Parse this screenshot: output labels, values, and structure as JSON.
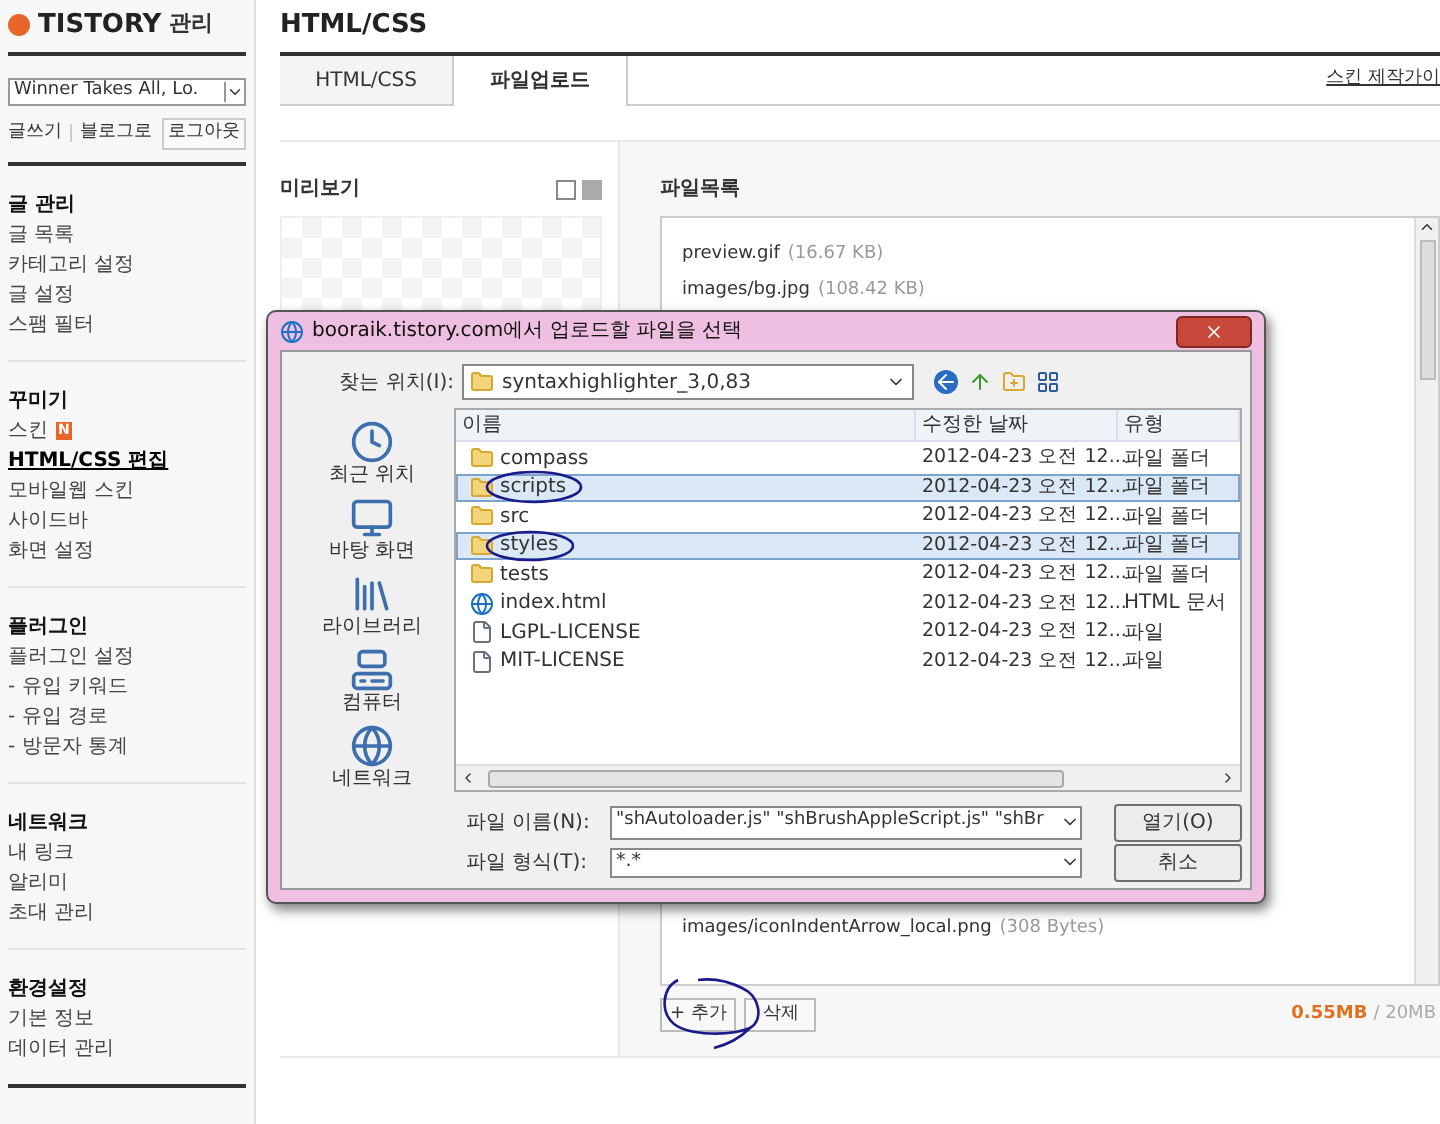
{
  "sidebar": {
    "logo": "TISTORY",
    "logo_suffix": "관리",
    "blog_select": "Winner Takes All, Lo.",
    "links": [
      "글쓰기",
      "블로그로"
    ],
    "logout": "로그아웃",
    "sections": [
      {
        "title": "글 관리",
        "items": [
          {
            "label": "글 목록",
            "selected": false
          },
          {
            "label": "카테고리 설정",
            "selected": false
          },
          {
            "label": "글 설정",
            "selected": false
          },
          {
            "label": "스팸 필터",
            "selected": false
          }
        ]
      },
      {
        "title": "꾸미기",
        "items": [
          {
            "label": "스킨",
            "selected": false,
            "badge": "N"
          },
          {
            "label": "HTML/CSS 편집",
            "selected": true
          },
          {
            "label": "모바일웹 스킨",
            "selected": false
          },
          {
            "label": "사이드바",
            "selected": false
          },
          {
            "label": "화면 설정",
            "selected": false
          }
        ]
      },
      {
        "title": "플러그인",
        "items": [
          {
            "label": "플러그인 설정",
            "selected": false
          },
          {
            "label": "- 유입 키워드",
            "selected": false
          },
          {
            "label": "- 유입 경로",
            "selected": false
          },
          {
            "label": "- 방문자 통계",
            "selected": false
          }
        ]
      },
      {
        "title": "네트워크",
        "items": [
          {
            "label": "내 링크",
            "selected": false
          },
          {
            "label": "알리미",
            "selected": false
          },
          {
            "label": "초대 관리",
            "selected": false
          }
        ]
      },
      {
        "title": "환경설정",
        "items": [
          {
            "label": "기본 정보",
            "selected": false
          },
          {
            "label": "데이터 관리",
            "selected": false
          }
        ]
      }
    ]
  },
  "page": {
    "title": "HTML/CSS",
    "tabs": [
      {
        "label": "HTML/CSS",
        "selected": false
      },
      {
        "label": "파일업로드",
        "selected": true
      }
    ],
    "guide_link": "스킨 제작가이",
    "preview": {
      "title": "미리보기"
    },
    "file_list": {
      "title": "파일목록",
      "rows": [
        {
          "name": "preview.gif",
          "size": "(16.67 KB)"
        },
        {
          "name": "images/bg.jpg",
          "size": "(108.42 KB)"
        }
      ],
      "bottom_rows": [
        {
          "name": "images/iconIndentArrow_local.png",
          "size": "(308 Bytes)"
        }
      ]
    },
    "add_button": "+ 추가",
    "delete_button": "삭제",
    "usage": "0.55MB",
    "quota": "/ 20MB"
  },
  "dialog": {
    "title": "booraik.tistory.com에서 업로드할 파일을 선택",
    "look_in_label": "찾는 위치(I):",
    "look_in": "syntaxhighlighter_3,0,83",
    "places": [
      {
        "label": "최근 위치",
        "kind": "recent"
      },
      {
        "label": "바탕 화면",
        "kind": "desktop"
      },
      {
        "label": "라이브러리",
        "kind": "library"
      },
      {
        "label": "컴퓨터",
        "kind": "computer"
      },
      {
        "label": "네트워크",
        "kind": "network"
      }
    ],
    "columns": [
      "이름",
      "수정한 날짜",
      "유형"
    ],
    "files": [
      {
        "name": "compass",
        "date": "2012-04-23 오전 12...",
        "type": "파일 폴더",
        "kind": "folder",
        "selected": false
      },
      {
        "name": "scripts",
        "date": "2012-04-23 오전 12...",
        "type": "파일 폴더",
        "kind": "folder",
        "selected": true
      },
      {
        "name": "src",
        "date": "2012-04-23 오전 12...",
        "type": "파일 폴더",
        "kind": "folder",
        "selected": false
      },
      {
        "name": "styles",
        "date": "2012-04-23 오전 12...",
        "type": "파일 폴더",
        "kind": "folder",
        "selected": true
      },
      {
        "name": "tests",
        "date": "2012-04-23 오전 12...",
        "type": "파일 폴더",
        "kind": "folder",
        "selected": false
      },
      {
        "name": "index.html",
        "date": "2012-04-23 오전 12...",
        "type": "HTML 문서",
        "kind": "html",
        "selected": false
      },
      {
        "name": "LGPL-LICENSE",
        "date": "2012-04-23 오전 12...",
        "type": "파일",
        "kind": "file",
        "selected": false
      },
      {
        "name": "MIT-LICENSE",
        "date": "2012-04-23 오전 12...",
        "type": "파일",
        "kind": "file",
        "selected": false
      }
    ],
    "file_name_label": "파일 이름(N):",
    "file_name": "\"shAutoloader.js\" \"shBrushAppleScript.js\" \"shBr",
    "file_type_label": "파일 형식(T):",
    "file_type": "*.*",
    "open_button": "열기(O)",
    "cancel_button": "취소"
  }
}
